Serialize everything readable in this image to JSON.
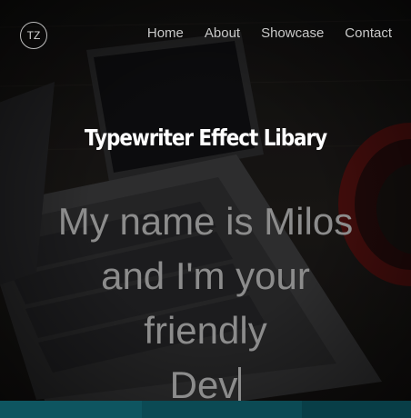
{
  "logo": {
    "text": "TZ"
  },
  "nav": {
    "items": [
      {
        "label": "Home"
      },
      {
        "label": "About"
      },
      {
        "label": "Showcase"
      },
      {
        "label": "Contact"
      }
    ]
  },
  "hero": {
    "title": "Typewriter Effect Libary",
    "typed_lines": [
      "My name is Milos",
      "and I'm your",
      "friendly",
      "Dev"
    ]
  },
  "colors": {
    "footer_segments": [
      "#0e5560",
      "#0b4a54",
      "#083e47"
    ]
  }
}
